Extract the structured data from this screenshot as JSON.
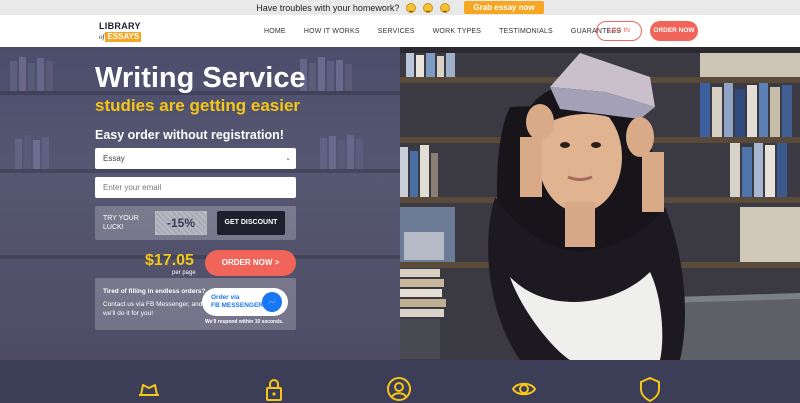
{
  "promo": {
    "text": "Have troubles with your homework?",
    "emoji_icons": [
      "smile-icon",
      "star-eyes-icon",
      "wow-icon"
    ],
    "button": "Grab essay now",
    "button_color": "#f5a623"
  },
  "header": {
    "logo": {
      "line1": "LIBRARY",
      "of": "of",
      "essays": "ESSAYS"
    },
    "nav": [
      "HOME",
      "HOW IT WORKS",
      "SERVICES",
      "WORK TYPES",
      "TESTIMONIALS",
      "GUARANTEES"
    ],
    "login": "LOG IN",
    "order": "ORDER NOW",
    "accent_color": "#f06459"
  },
  "hero": {
    "title": "Writing Service",
    "subtitle": "studies are getting easier",
    "easy_order": "Easy order without registration!",
    "paper_type": {
      "selected": "Essay"
    },
    "email": {
      "placeholder": "Enter your email"
    },
    "luck": {
      "label": "TRY YOUR LUCK!",
      "discount": "-15%",
      "button": "GET DISCOUNT"
    },
    "price": "$17.05",
    "per_page": "per page",
    "order_button": "ORDER NOW >",
    "fb": {
      "tired": "Tired of filling in endless orders?",
      "contact": "Contact us via FB Messenger, and we'll do it for you!",
      "button_line1": "Order via",
      "button_line2": "FB MESSENGER",
      "respond": "We'll respond within 10 seconds."
    }
  },
  "features": {
    "icons": [
      "hat-icon",
      "lock-icon",
      "user-icon",
      "eye-icon",
      "shield-icon"
    ],
    "icon_color": "#f5c518"
  }
}
